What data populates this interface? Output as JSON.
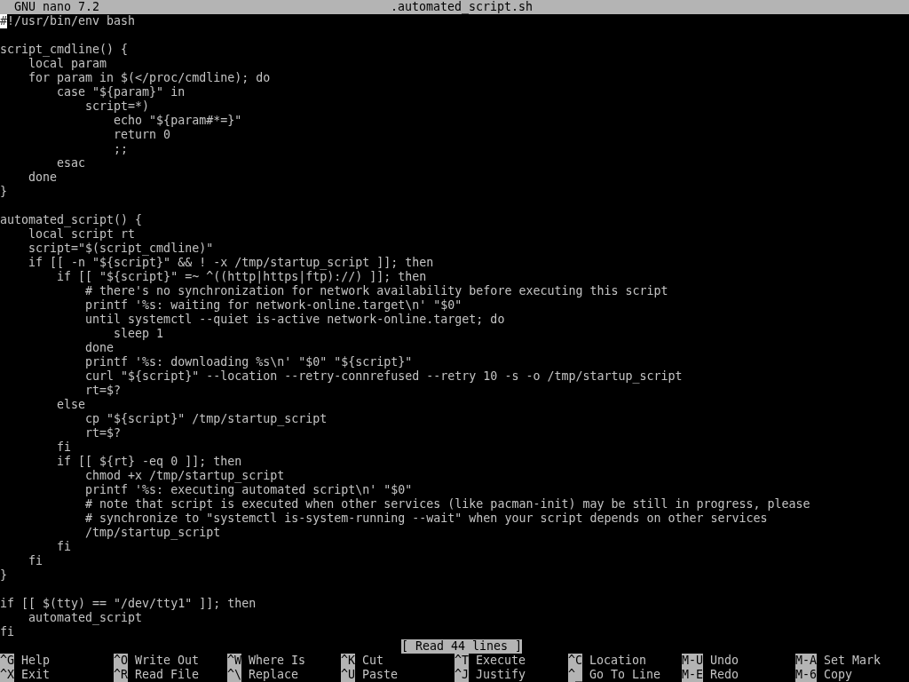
{
  "title_bar": {
    "app": "GNU nano 7.2",
    "file": ".automated_script.sh"
  },
  "lines": [
    {
      "kind": "code",
      "text": "#!/usr/bin/env bash",
      "cursor": true
    },
    {
      "kind": "blank"
    },
    {
      "kind": "code",
      "text": "script_cmdline() {",
      "cursor": false
    },
    {
      "kind": "code",
      "text": "    local param",
      "cursor": false
    },
    {
      "kind": "code",
      "text": "    for param in $(</proc/cmdline); do",
      "cursor": false
    },
    {
      "kind": "code",
      "text": "        case \"${param}\" in",
      "cursor": false
    },
    {
      "kind": "code",
      "text": "            script=*)",
      "cursor": false
    },
    {
      "kind": "code",
      "text": "                echo \"${param#*=}\"",
      "cursor": false
    },
    {
      "kind": "code",
      "text": "                return 0",
      "cursor": false
    },
    {
      "kind": "code",
      "text": "                ;;",
      "cursor": false
    },
    {
      "kind": "code",
      "text": "        esac",
      "cursor": false
    },
    {
      "kind": "code",
      "text": "    done",
      "cursor": false
    },
    {
      "kind": "code",
      "text": "}",
      "cursor": false
    },
    {
      "kind": "blank"
    },
    {
      "kind": "code",
      "text": "automated_script() {",
      "cursor": false
    },
    {
      "kind": "code",
      "text": "    local script rt",
      "cursor": false
    },
    {
      "kind": "code",
      "text": "    script=\"$(script_cmdline)\"",
      "cursor": false
    },
    {
      "kind": "code",
      "text": "    if [[ -n \"${script}\" && ! -x /tmp/startup_script ]]; then",
      "cursor": false
    },
    {
      "kind": "code",
      "text": "        if [[ \"${script}\" =~ ^((http|https|ftp)://) ]]; then",
      "cursor": false
    },
    {
      "kind": "code",
      "text": "            # there's no synchronization for network availability before executing this script",
      "cursor": false
    },
    {
      "kind": "code",
      "text": "            printf '%s: waiting for network-online.target\\n' \"$0\"",
      "cursor": false
    },
    {
      "kind": "code",
      "text": "            until systemctl --quiet is-active network-online.target; do",
      "cursor": false
    },
    {
      "kind": "code",
      "text": "                sleep 1",
      "cursor": false
    },
    {
      "kind": "code",
      "text": "            done",
      "cursor": false
    },
    {
      "kind": "code",
      "text": "            printf '%s: downloading %s\\n' \"$0\" \"${script}\"",
      "cursor": false
    },
    {
      "kind": "code",
      "text": "            curl \"${script}\" --location --retry-connrefused --retry 10 -s -o /tmp/startup_script",
      "cursor": false
    },
    {
      "kind": "code",
      "text": "            rt=$?",
      "cursor": false
    },
    {
      "kind": "code",
      "text": "        else",
      "cursor": false
    },
    {
      "kind": "code",
      "text": "            cp \"${script}\" /tmp/startup_script",
      "cursor": false
    },
    {
      "kind": "code",
      "text": "            rt=$?",
      "cursor": false
    },
    {
      "kind": "code",
      "text": "        fi",
      "cursor": false
    },
    {
      "kind": "code",
      "text": "        if [[ ${rt} -eq 0 ]]; then",
      "cursor": false
    },
    {
      "kind": "code",
      "text": "            chmod +x /tmp/startup_script",
      "cursor": false
    },
    {
      "kind": "code",
      "text": "            printf '%s: executing automated script\\n' \"$0\"",
      "cursor": false
    },
    {
      "kind": "code",
      "text": "            # note that script is executed when other services (like pacman-init) may be still in progress, please",
      "cursor": false
    },
    {
      "kind": "code",
      "text": "            # synchronize to \"systemctl is-system-running --wait\" when your script depends on other services",
      "cursor": false
    },
    {
      "kind": "code",
      "text": "            /tmp/startup_script",
      "cursor": false
    },
    {
      "kind": "code",
      "text": "        fi",
      "cursor": false
    },
    {
      "kind": "code",
      "text": "    fi",
      "cursor": false
    },
    {
      "kind": "code",
      "text": "}",
      "cursor": false
    },
    {
      "kind": "blank"
    },
    {
      "kind": "code",
      "text": "if [[ $(tty) == \"/dev/tty1\" ]]; then",
      "cursor": false
    },
    {
      "kind": "code",
      "text": "    automated_script",
      "cursor": false
    },
    {
      "kind": "code",
      "text": "fi",
      "cursor": false
    }
  ],
  "status": "[ Read 44 lines ]",
  "shortcuts": [
    {
      "key": "^G",
      "label": "Help"
    },
    {
      "key": "^O",
      "label": "Write Out"
    },
    {
      "key": "^W",
      "label": "Where Is"
    },
    {
      "key": "^K",
      "label": "Cut"
    },
    {
      "key": "^T",
      "label": "Execute"
    },
    {
      "key": "^C",
      "label": "Location"
    },
    {
      "key": "M-U",
      "label": "Undo"
    },
    {
      "key": "M-A",
      "label": "Set Mark"
    },
    {
      "key": "^X",
      "label": "Exit"
    },
    {
      "key": "^R",
      "label": "Read File"
    },
    {
      "key": "^\\",
      "label": "Replace"
    },
    {
      "key": "^U",
      "label": "Paste"
    },
    {
      "key": "^J",
      "label": "Justify"
    },
    {
      "key": "^_",
      "label": "Go To Line"
    },
    {
      "key": "M-E",
      "label": "Redo"
    },
    {
      "key": "M-6",
      "label": "Copy"
    }
  ]
}
